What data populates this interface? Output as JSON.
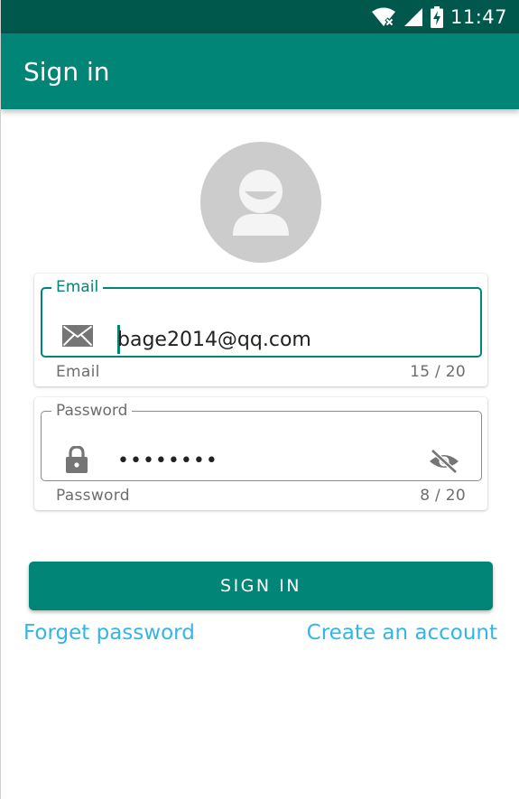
{
  "status_bar": {
    "time": "11:47",
    "icons": [
      "wifi-off-icon",
      "signal-icon",
      "battery-charging-icon"
    ]
  },
  "app_bar": {
    "title": "Sign in"
  },
  "avatar": {
    "icon": "person-icon"
  },
  "email_field": {
    "label": "Email",
    "value": "bage2014@qq.com",
    "helper": "Email",
    "counter": "15 / 20",
    "icon": "email-icon",
    "focused": true
  },
  "password_field": {
    "label": "Password",
    "value": "••••••••",
    "helper": "Password",
    "counter": "8 / 20",
    "icon": "lock-icon",
    "toggle_icon": "visibility-off-icon"
  },
  "signin_button": {
    "label": "SIGN IN"
  },
  "links": {
    "forget_password": "Forget password",
    "create_account": "Create an account"
  },
  "colors": {
    "primary": "#008577",
    "primary_dark": "#00574b",
    "link": "#33b5e5",
    "avatar_bg": "#cccccc"
  }
}
